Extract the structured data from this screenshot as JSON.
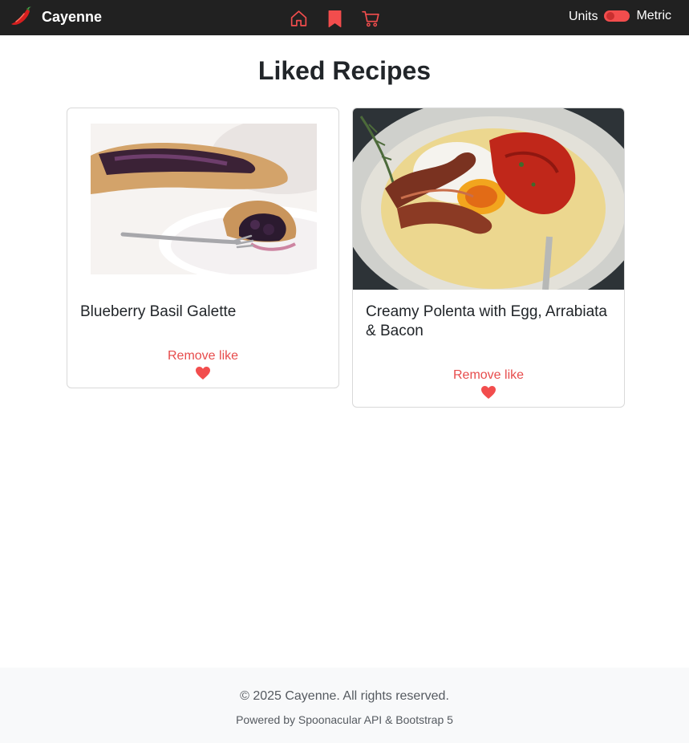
{
  "navbar": {
    "brand_name": "Cayenne",
    "brand_icon": "chili-pepper-icon",
    "nav_items": [
      {
        "icon": "home-icon"
      },
      {
        "icon": "bookmark-icon"
      },
      {
        "icon": "cart-icon"
      }
    ],
    "units_label": "Units",
    "units_toggle_value": "Metric",
    "accent_color": "#f24d4d"
  },
  "main": {
    "title": "Liked Recipes",
    "recipes": [
      {
        "title": "Blueberry Basil Galette",
        "action_label": "Remove like",
        "action_icon": "heart-icon"
      },
      {
        "title": "Creamy Polenta with Egg, Arrabiata & Bacon",
        "action_label": "Remove like",
        "action_icon": "heart-icon"
      }
    ]
  },
  "footer": {
    "copyright": "© 2025 Cayenne. All rights reserved.",
    "powered_by": "Powered by Spoonacular API & Bootstrap 5"
  }
}
